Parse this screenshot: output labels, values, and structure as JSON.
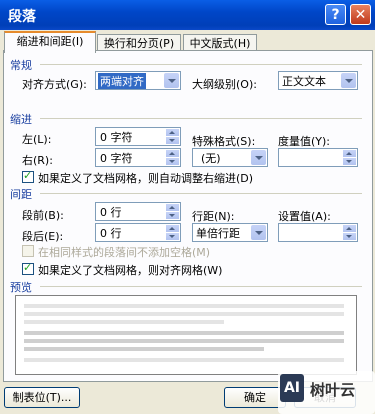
{
  "window": {
    "title": "段落",
    "help_glyph": "?",
    "close_glyph": "✕"
  },
  "tabs": [
    {
      "label": "缩进和间距(I)"
    },
    {
      "label": "换行和分页(P)"
    },
    {
      "label": "中文版式(H)"
    }
  ],
  "general": {
    "heading": "常规",
    "align_label": "对齐方式(G):",
    "align_value": "两端对齐",
    "outline_label": "大纲级别(O):",
    "outline_value": "正文文本"
  },
  "indent": {
    "heading": "缩进",
    "left_label": "左(L):",
    "left_value": "0 字符",
    "right_label": "右(R):",
    "right_value": "0 字符",
    "special_label": "特殊格式(S):",
    "special_value": "(无)",
    "measure_label": "度量值(Y):",
    "measure_value": "",
    "grid_check_label": "如果定义了文档网格，则自动调整右缩进(D)",
    "grid_check": true
  },
  "spacing": {
    "heading": "间距",
    "before_label": "段前(B):",
    "before_value": "0 行",
    "after_label": "段后(E):",
    "after_value": "0 行",
    "line_label": "行距(N):",
    "line_value": "单倍行距",
    "setting_label": "设置值(A):",
    "setting_value": "",
    "same_style_label": "在相同样式的段落间不添加空格(M)",
    "same_style_check": false,
    "snap_grid_label": "如果定义了文档网格，则对齐网格(W)",
    "snap_grid_check": true
  },
  "preview": {
    "heading": "预览"
  },
  "buttons": {
    "tabs_label": "制表位(T)...",
    "ok_label": "确定",
    "cancel_label": "取消"
  },
  "watermark": {
    "logo": "AI",
    "text": "树叶云"
  },
  "colors": {
    "title_bar": "#0046c8",
    "group_heading": "#1a3fa0",
    "selection": "#316ac5",
    "tab_highlight": "#e68b2c"
  }
}
